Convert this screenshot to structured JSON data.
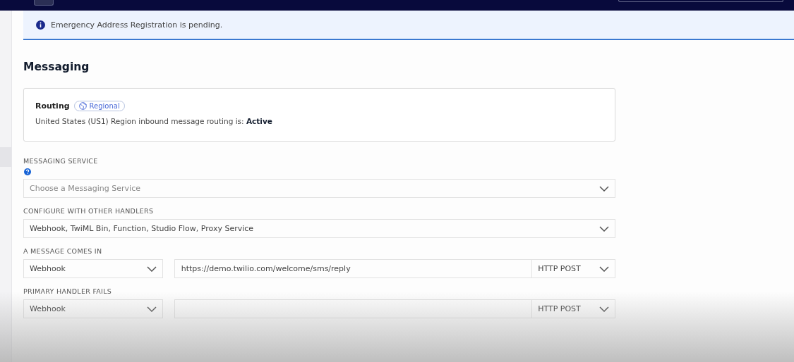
{
  "banner": {
    "text": "Emergency Address Registration is pending."
  },
  "page_title": "Messaging",
  "routing": {
    "title": "Routing",
    "badge": "Regional",
    "text": "United States (US1) Region inbound message routing is: **Active**"
  },
  "fields": [
    {
      "kind": "select",
      "label": "MESSAGING SERVICE",
      "help": true,
      "placeholder": "Choose a Messaging Service"
    },
    {
      "kind": "select",
      "label": "CONFIGURE WITH OTHER HANDLERS",
      "value": "Webhook, TwiML Bin, Function, Studio Flow, Proxy Service"
    },
    {
      "kind": "handler",
      "label": "A MESSAGE COMES IN",
      "type": "Webhook",
      "url": "https://demo.twilio.com/welcome/sms/reply",
      "method": "HTTP POST"
    },
    {
      "kind": "handler",
      "label": "PRIMARY HANDLER FAILS",
      "type": "Webhook",
      "method": "HTTP POST"
    }
  ]
}
